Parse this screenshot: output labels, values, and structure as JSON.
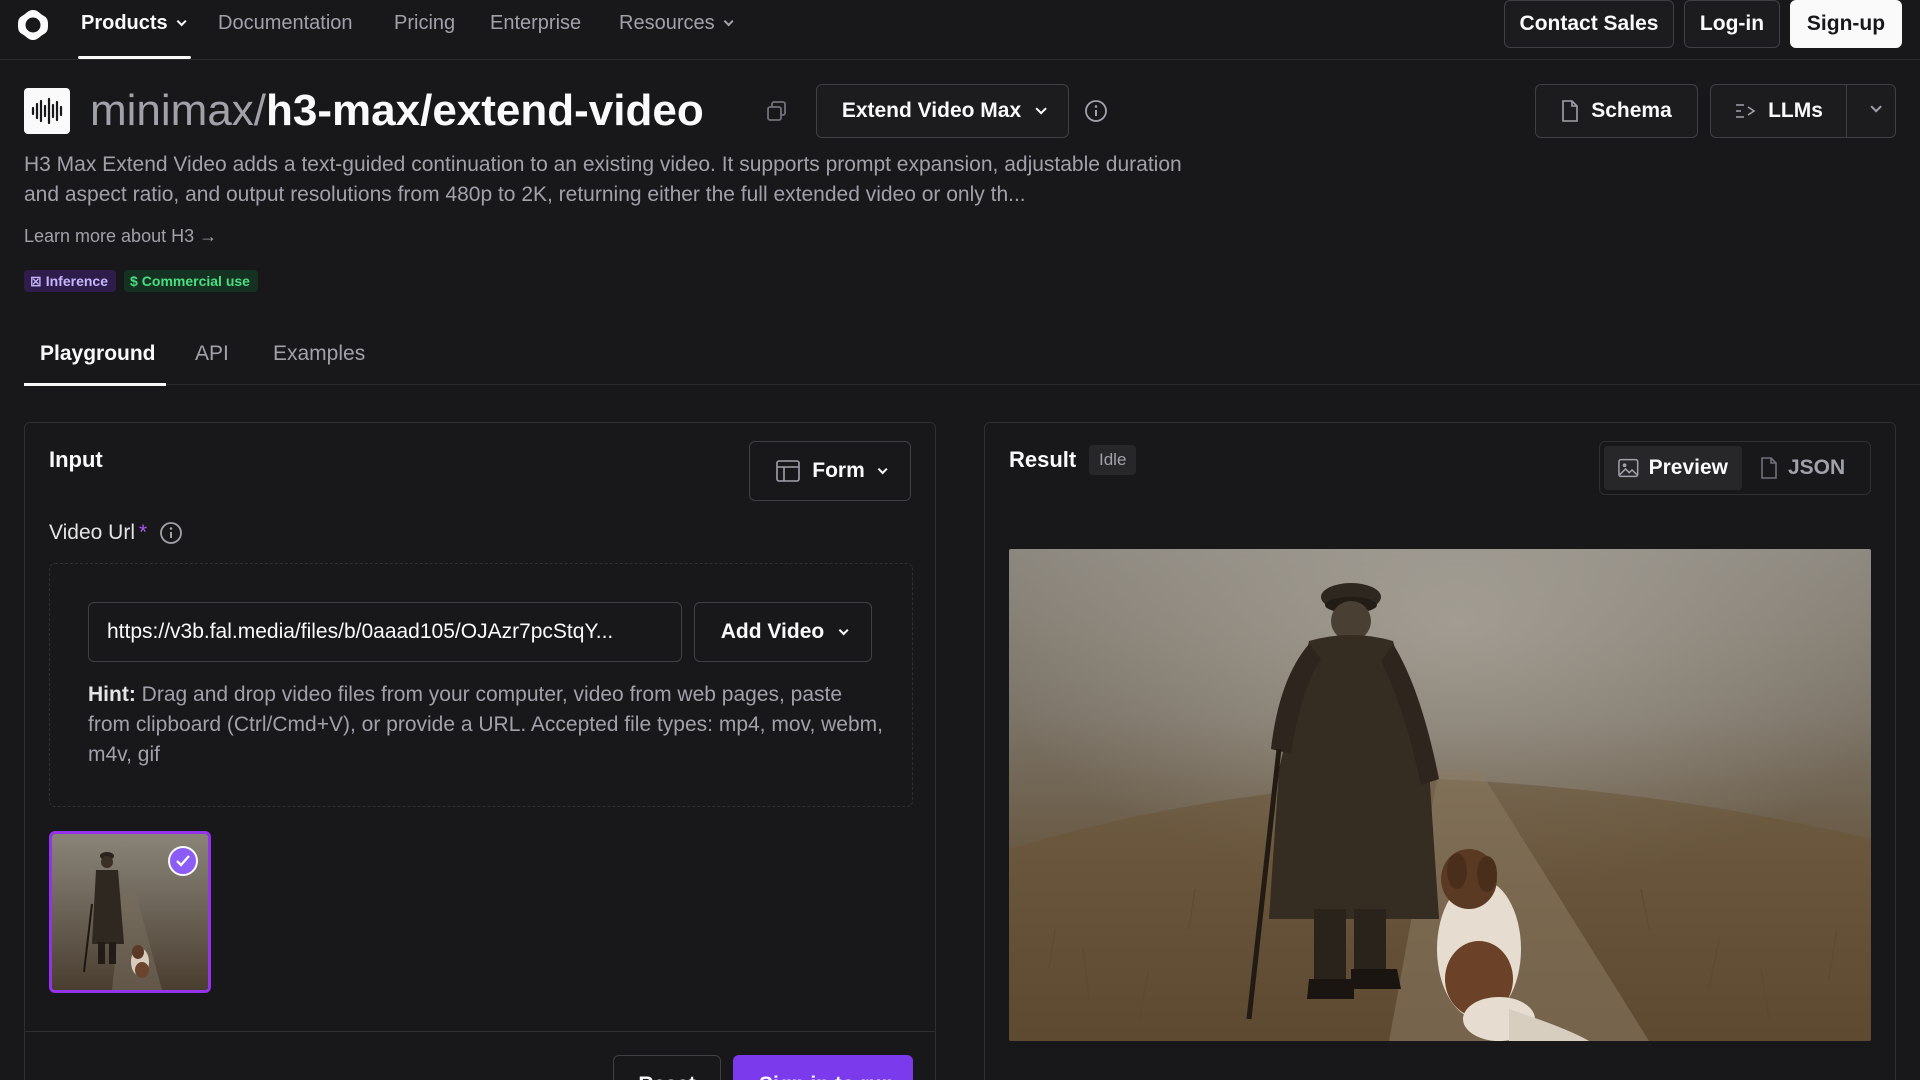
{
  "nav": {
    "items": [
      {
        "label": "Products",
        "has_menu": true,
        "active": true
      },
      {
        "label": "Documentation"
      },
      {
        "label": "Pricing"
      },
      {
        "label": "Enterprise"
      },
      {
        "label": "Resources",
        "has_menu": true
      }
    ],
    "contact_sales": "Contact Sales",
    "login": "Log-in",
    "signup": "Sign-up"
  },
  "model": {
    "namespace": "minimax/",
    "name": "h3-max/extend-video",
    "variant": "Extend Video Max",
    "description": "H3 Max Extend Video adds a text-guided continuation to an existing video. It supports prompt expansion, adjustable duration and aspect ratio, and output resolutions from 480p to 2K, returning either the full extended video or only th...",
    "learn_more": "Learn more about H3",
    "badges": [
      "Inference",
      "Commercial use"
    ]
  },
  "header_actions": {
    "schema": "Schema",
    "llms": "LLMs"
  },
  "tabs": [
    "Playground",
    "API",
    "Examples"
  ],
  "input_panel": {
    "title": "Input",
    "view_mode": "Form",
    "field_label": "Video Url",
    "required_marker": "*",
    "url_value": "https://v3b.fal.media/files/b/0aaad105/OJAzr7pcStqY...",
    "add_video": "Add Video",
    "hint_label": "Hint:",
    "hint_text": " Drag and drop video files from your computer, video from web pages, paste from clipboard (Ctrl/Cmd+V), or provide a URL. Accepted file types: mp4, mov, webm, m4v, gif",
    "reset": "Reset",
    "run": "Sign in to run"
  },
  "result_panel": {
    "title": "Result",
    "status": "Idle",
    "preview": "Preview",
    "json": "JSON"
  },
  "colors": {
    "background": "#18181b",
    "accent": "#7c3aed",
    "selection": "#9333ea"
  },
  "icons": [
    "logo-icon",
    "chevron-down-icon",
    "copy-icon",
    "info-icon",
    "file-icon",
    "llm-icon",
    "layout-icon",
    "image-icon",
    "check-icon",
    "arrow-right-icon"
  ]
}
